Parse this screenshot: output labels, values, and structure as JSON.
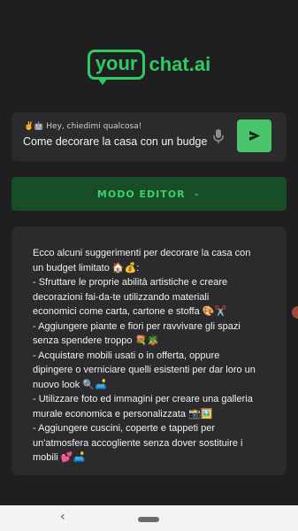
{
  "logo": {
    "boxed": "your",
    "rest": "chat.ai"
  },
  "prompt": {
    "hint": "✌️🤖 Hey, chiedimi qualcosa!",
    "value": "Come decorare la casa con un budget limitato"
  },
  "editor": {
    "label": "MODO EDITOR",
    "chevron": "⌄"
  },
  "answer": {
    "lines": [
      "Ecco alcuni suggerimenti per decorare la casa con",
      "un budget limitato 🏠💰:",
      "- Sfruttare le proprie abilità artistiche e creare",
      "decorazioni fai-da-te utilizzando materiali",
      "economici come carta, cartone e stoffa 🎨✂️",
      "- Aggiungere piante e fiori per ravvivare gli spazi",
      "senza spendere troppo 💐🪴",
      "- Acquistare mobili usati o in offerta, oppure",
      "dipingere o verniciare quelli esistenti per dar loro un",
      "nuovo look 🔍🛋️",
      "- Utilizzare foto ed immagini per creare una galleria",
      "murale economica e personalizzata 📸🖼️",
      "- Aggiungere cuscini, coperte e tappeti per",
      "un'atmosfera accogliente senza dover sostituire i",
      "mobili 💕🛋️"
    ]
  },
  "navbar": {
    "back": "‹"
  },
  "icons": {
    "mic": "mic-icon",
    "send": "send-icon"
  },
  "colors": {
    "accent": "#2fca63",
    "background": "#1f1f21",
    "card": "#2b2b2e",
    "editor_bg": "#174d27"
  }
}
